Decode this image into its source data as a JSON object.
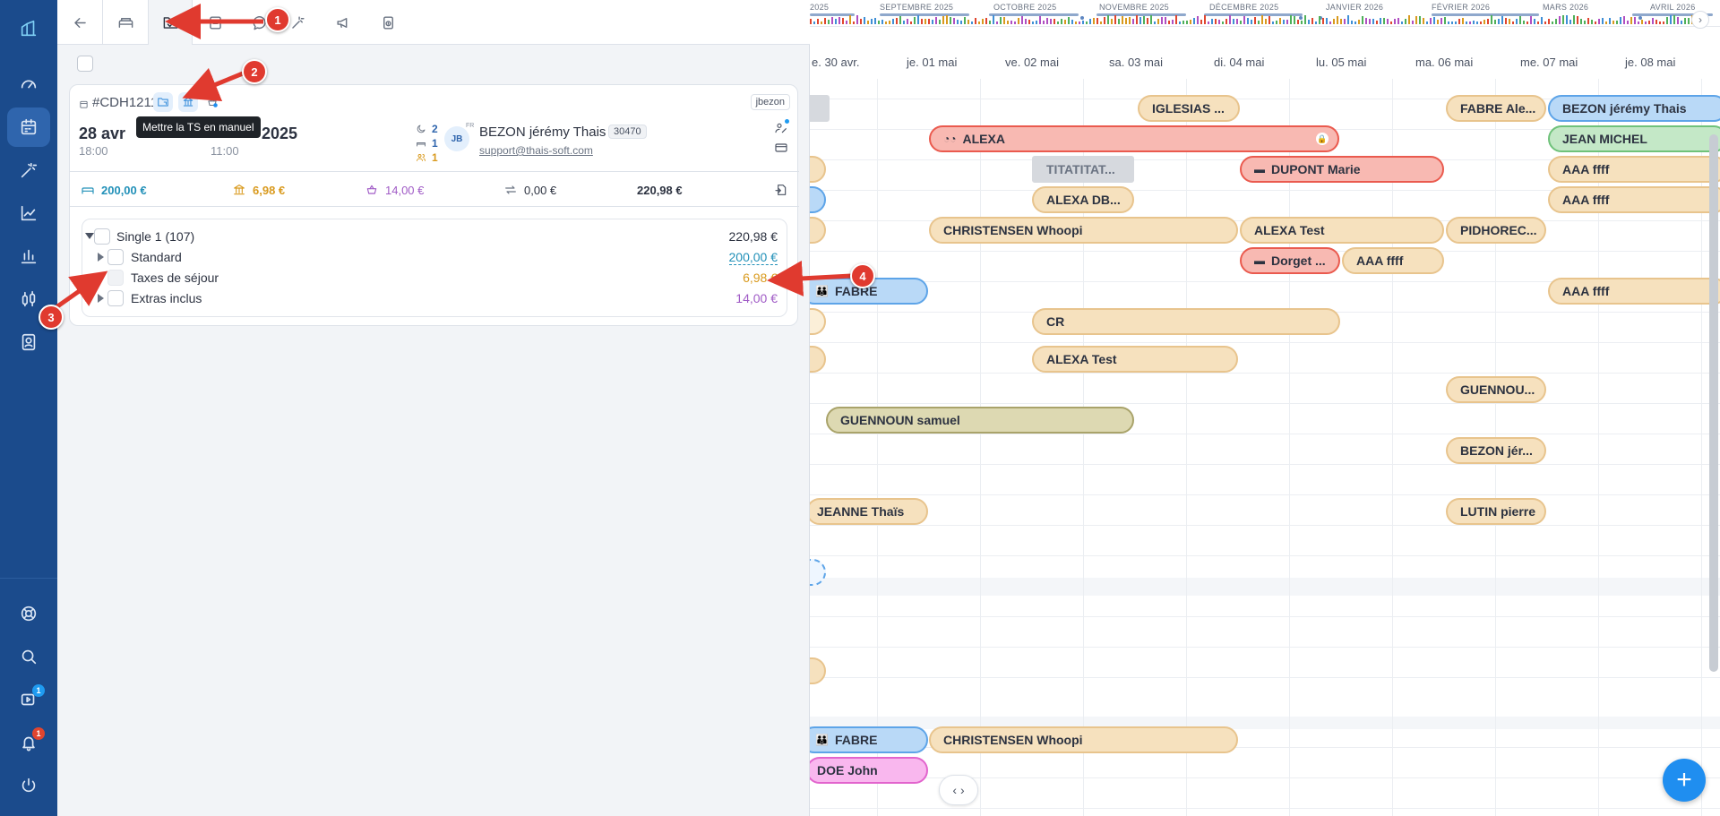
{
  "sidebar": {
    "items": [
      {
        "icon": "logo-icon"
      },
      {
        "icon": "dashboard-icon"
      },
      {
        "icon": "calendar-icon",
        "active": true
      },
      {
        "icon": "magic-wand-icon"
      },
      {
        "icon": "chart-line-icon"
      },
      {
        "icon": "stats-icon"
      },
      {
        "icon": "sliders-icon"
      },
      {
        "icon": "contacts-icon"
      }
    ],
    "bottom": [
      {
        "icon": "help-icon"
      },
      {
        "icon": "search-icon"
      },
      {
        "icon": "video-icon",
        "badge": "1"
      },
      {
        "icon": "bell-icon",
        "badge": "1"
      },
      {
        "icon": "power-icon"
      }
    ]
  },
  "toolbar": {
    "buttons": [
      "back-arrow-icon",
      "bed-icon",
      "folder-check-icon",
      "document-icon",
      "chat-icon",
      "magic-icon",
      "megaphone-icon",
      "lock-file-icon"
    ]
  },
  "reservation": {
    "id": "#CDH1211",
    "user": "jbezon",
    "tooltip": "Mettre la TS en manuel",
    "arrival_date": "28 avr",
    "departure_year": "2025",
    "arrival_time": "18:00",
    "departure_time": "11:00",
    "nights": "2",
    "rooms": "1",
    "guests": "1",
    "guest": {
      "initials": "JB",
      "lang": "FR",
      "name": "BEZON jérémy Thais",
      "code": "30470",
      "email": "support@thais-soft.com"
    },
    "totals": {
      "accommodation": "200,00 €",
      "tax": "6,98 €",
      "extras": "14,00 €",
      "transfer": "0,00 €",
      "total": "220,98 €"
    },
    "lines": {
      "group_label": "Single 1 (107)",
      "group_value": "220,98 €",
      "items": [
        {
          "label": "Standard",
          "value": "200,00 €",
          "color": "#2190b8"
        },
        {
          "label": "Taxes de séjour",
          "value": "6,98 €",
          "color": "#d99a1e"
        },
        {
          "label": "Extras inclus",
          "value": "14,00 €",
          "color": "#a05bc6"
        }
      ]
    }
  },
  "annotations": [
    "1",
    "2",
    "3",
    "4"
  ],
  "planning": {
    "months": [
      {
        "label": "2025"
      },
      {
        "label": "SEPTEMBRE 2025"
      },
      {
        "label": "OCTOBRE 2025"
      },
      {
        "label": "NOVEMBRE 2025"
      },
      {
        "label": "DÉCEMBRE 2025"
      },
      {
        "label": "JANVIER 2026"
      },
      {
        "label": "FÉVRIER 2026"
      },
      {
        "label": "MARS 2026"
      },
      {
        "label": "AVRIL 2026"
      }
    ],
    "days": [
      "e. 30 avr.",
      "je. 01 mai",
      "ve. 02 mai",
      "sa. 03 mai",
      "di. 04 mai",
      "lu. 05 mai",
      "ma. 06 mai",
      "me. 07 mai",
      "je. 08 mai"
    ],
    "bookings": [
      {
        "label": "IGLESIAS ...",
        "color": "tan"
      },
      {
        "label": "FABRE Ale...",
        "color": "tan"
      },
      {
        "label": "BEZON jérémy Thais",
        "color": "blue"
      },
      {
        "label": "ALEXA",
        "color": "red",
        "icon": "moto-icon",
        "locked": true
      },
      {
        "label": "JEAN MICHEL",
        "color": "green"
      },
      {
        "label": "TITATITAT...",
        "color": "grey"
      },
      {
        "label": "DUPONT Marie",
        "color": "red",
        "icon": "card-icon"
      },
      {
        "label": "AAA ffff",
        "color": "tan"
      },
      {
        "label": "ALEXA DB...",
        "color": "tan"
      },
      {
        "label": "AAA ffff",
        "color": "tan"
      },
      {
        "label": "CHRISTENSEN Whoopi",
        "color": "tan"
      },
      {
        "label": "ALEXA Test",
        "color": "tan"
      },
      {
        "label": "PIDHOREC...",
        "color": "tan"
      },
      {
        "label": "Dorget ...",
        "color": "red",
        "icon": "card-icon"
      },
      {
        "label": "AAA ffff",
        "color": "tan"
      },
      {
        "label": "FABRE",
        "color": "blue",
        "icon": "group-icon"
      },
      {
        "label": "AAA ffff",
        "color": "tan"
      },
      {
        "label": "CR",
        "color": "tan"
      },
      {
        "label": "ALEXA Test",
        "color": "tan"
      },
      {
        "label": "GUENNOU...",
        "color": "tan"
      },
      {
        "label": "GUENNOUN samuel",
        "color": "olive"
      },
      {
        "label": "BEZON jér...",
        "color": "tan"
      },
      {
        "label": "JEANNE Thaïs",
        "color": "tan"
      },
      {
        "label": "LUTIN pierre",
        "color": "tan"
      },
      {
        "label": "FABRE",
        "color": "blue",
        "icon": "group-icon"
      },
      {
        "label": "CHRISTENSEN Whoopi",
        "color": "tan"
      },
      {
        "label": "DOE John",
        "color": "pink"
      }
    ]
  }
}
